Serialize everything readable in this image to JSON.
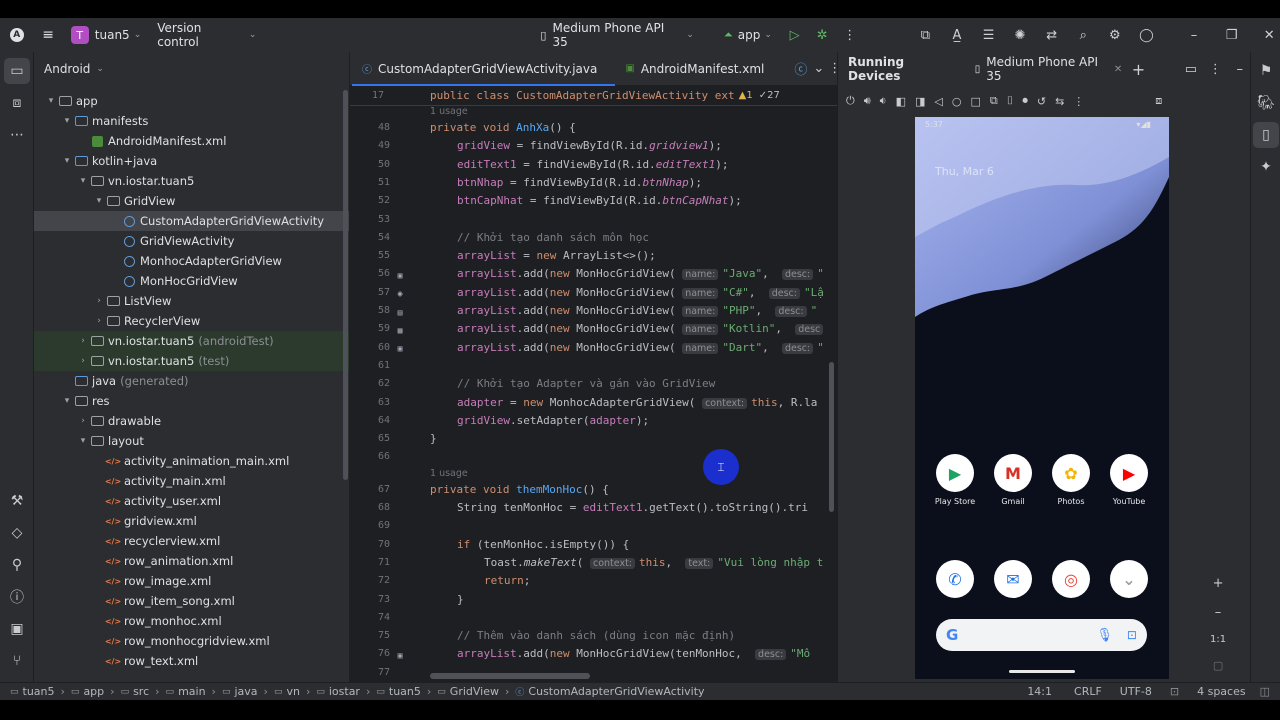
{
  "titlebar": {
    "project_initial": "T",
    "project_name": "tuan5",
    "vcs": "Version control",
    "device": "Medium Phone API 35",
    "run_config": "app"
  },
  "project_panel": {
    "view_mode": "Android",
    "tree": [
      {
        "label": "app",
        "indent": 0,
        "arrow": "▾",
        "icon": "folder"
      },
      {
        "label": "manifests",
        "indent": 1,
        "arrow": "▾",
        "icon": "folder-blue"
      },
      {
        "label": "AndroidManifest.xml",
        "indent": 2,
        "arrow": "",
        "icon": "manifest"
      },
      {
        "label": "kotlin+java",
        "indent": 1,
        "arrow": "▾",
        "icon": "folder-blue"
      },
      {
        "label": "vn.iostar.tuan5",
        "indent": 2,
        "arrow": "▾",
        "icon": "folder"
      },
      {
        "label": "GridView",
        "indent": 3,
        "arrow": "▾",
        "icon": "folder"
      },
      {
        "label": "CustomAdapterGridViewActivity",
        "indent": 4,
        "arrow": "",
        "icon": "class",
        "selected": true
      },
      {
        "label": "GridViewActivity",
        "indent": 4,
        "arrow": "",
        "icon": "class"
      },
      {
        "label": "MonhocAdapterGridView",
        "indent": 4,
        "arrow": "",
        "icon": "class"
      },
      {
        "label": "MonHocGridView",
        "indent": 4,
        "arrow": "",
        "icon": "class"
      },
      {
        "label": "ListView",
        "indent": 3,
        "arrow": "›",
        "icon": "folder"
      },
      {
        "label": "RecyclerView",
        "indent": 3,
        "arrow": "›",
        "icon": "folder"
      },
      {
        "label": "vn.iostar.tuan5",
        "suffix": "(androidTest)",
        "indent": 2,
        "arrow": "›",
        "icon": "folder",
        "green": true
      },
      {
        "label": "vn.iostar.tuan5",
        "suffix": "(test)",
        "indent": 2,
        "arrow": "›",
        "icon": "folder",
        "green": true
      },
      {
        "label": "java",
        "suffix": "(generated)",
        "indent": 1,
        "arrow": "",
        "icon": "folder-blue"
      },
      {
        "label": "res",
        "indent": 1,
        "arrow": "▾",
        "icon": "folder"
      },
      {
        "label": "drawable",
        "indent": 2,
        "arrow": "›",
        "icon": "folder"
      },
      {
        "label": "layout",
        "indent": 2,
        "arrow": "▾",
        "icon": "folder"
      },
      {
        "label": "activity_animation_main.xml",
        "indent": 3,
        "arrow": "",
        "icon": "xml"
      },
      {
        "label": "activity_main.xml",
        "indent": 3,
        "arrow": "",
        "icon": "xml"
      },
      {
        "label": "activity_user.xml",
        "indent": 3,
        "arrow": "",
        "icon": "xml"
      },
      {
        "label": "gridview.xml",
        "indent": 3,
        "arrow": "",
        "icon": "xml"
      },
      {
        "label": "recyclerview.xml",
        "indent": 3,
        "arrow": "",
        "icon": "xml"
      },
      {
        "label": "row_animation.xml",
        "indent": 3,
        "arrow": "",
        "icon": "xml"
      },
      {
        "label": "row_image.xml",
        "indent": 3,
        "arrow": "",
        "icon": "xml"
      },
      {
        "label": "row_item_song.xml",
        "indent": 3,
        "arrow": "",
        "icon": "xml"
      },
      {
        "label": "row_monhoc.xml",
        "indent": 3,
        "arrow": "",
        "icon": "xml"
      },
      {
        "label": "row_monhocgridview.xml",
        "indent": 3,
        "arrow": "",
        "icon": "xml"
      },
      {
        "label": "row_text.xml",
        "indent": 3,
        "arrow": "",
        "icon": "xml"
      }
    ]
  },
  "editor": {
    "tabs": [
      {
        "label": "CustomAdapterGridViewActivity.java",
        "active": true
      },
      {
        "label": "AndroidManifest.xml",
        "active": false
      }
    ],
    "sticky_line_no": "17",
    "sticky_code": "public class CustomAdapterGridViewActivity ext",
    "warnings": "▲1",
    "checks": "✓27",
    "lines": [
      {
        "n": "",
        "html": "<span class='usage'>1 usage</span>",
        "indent": 1
      },
      {
        "n": "48",
        "html": "<span class='kw'>private void</span> <span class='fn'>AnhXa</span>() {",
        "indent": 1
      },
      {
        "n": "49",
        "html": "<span class='fld'>gridView</span> = findViewById(R.id.<span class='it'>gridview1</span>);",
        "indent": 2
      },
      {
        "n": "50",
        "html": "<span class='fld'>editText1</span> = findViewById(R.id.<span class='it'>editText1</span>);",
        "indent": 2
      },
      {
        "n": "51",
        "html": "<span class='fld'>btnNhap</span> = findViewById(R.id.<span class='it'>btnNhap</span>);",
        "indent": 2
      },
      {
        "n": "52",
        "html": "<span class='fld'>btnCapNhat</span> = findViewById(R.id.<span class='it'>btnCapNhat</span>);",
        "indent": 2
      },
      {
        "n": "53",
        "html": "",
        "indent": 2
      },
      {
        "n": "54",
        "html": "<span class='cm'>// Khởi tạo danh sách môn học</span>",
        "indent": 2
      },
      {
        "n": "55",
        "html": "<span class='fld'>arrayList</span> = <span class='kw'>new</span> ArrayList&lt;&gt;();",
        "indent": 2
      },
      {
        "n": "56",
        "html": "<span class='fld'>arrayList</span>.add(<span class='kw'>new</span> MonHocGridView( <span class='hint'>name:</span><span class='str'>\"Java\"</span>,  <span class='hint'>desc:</span><span class='str'>\"</span>",
        "indent": 2,
        "gut": "▣"
      },
      {
        "n": "57",
        "html": "<span class='fld'>arrayList</span>.add(<span class='kw'>new</span> MonHocGridView( <span class='hint'>name:</span><span class='str'>\"C#\"</span>,  <span class='hint'>desc:</span><span class='str'>\"Lậ</span>",
        "indent": 2,
        "gut": "◉"
      },
      {
        "n": "58",
        "html": "<span class='fld'>arrayList</span>.add(<span class='kw'>new</span> MonHocGridView( <span class='hint'>name:</span><span class='str'>\"PHP\"</span>,  <span class='hint'>desc:</span><span class='str'>\"</span>",
        "indent": 2,
        "gut": "▤"
      },
      {
        "n": "59",
        "html": "<span class='fld'>arrayList</span>.add(<span class='kw'>new</span> MonHocGridView( <span class='hint'>name:</span><span class='str'>\"Kotlin\"</span>,  <span class='hint'>desc</span>",
        "indent": 2,
        "gut": "▦"
      },
      {
        "n": "60",
        "html": "<span class='fld'>arrayList</span>.add(<span class='kw'>new</span> MonHocGridView( <span class='hint'>name:</span><span class='str'>\"Dart\"</span>,  <span class='hint'>desc:</span><span class='str'>\"</span>",
        "indent": 2,
        "gut": "▣"
      },
      {
        "n": "61",
        "html": "",
        "indent": 2
      },
      {
        "n": "62",
        "html": "<span class='cm'>// Khởi tạo Adapter và gán vào GridView</span>",
        "indent": 2
      },
      {
        "n": "63",
        "html": "<span class='fld'>adapter</span> = <span class='kw'>new</span> MonhocAdapterGridView( <span class='hint'>context:</span><span class='kw'>this</span>, R.la",
        "indent": 2
      },
      {
        "n": "64",
        "html": "<span class='fld'>gridView</span>.setAdapter(<span class='fld'>adapter</span>);",
        "indent": 2
      },
      {
        "n": "65",
        "html": "}",
        "indent": 1
      },
      {
        "n": "66",
        "html": "",
        "indent": 1
      },
      {
        "n": "",
        "html": "<span class='usage'>1 usage</span>",
        "indent": 1
      },
      {
        "n": "67",
        "html": "<span class='kw'>private void</span> <span class='fn'>themMonHoc</span>() {",
        "indent": 1
      },
      {
        "n": "68",
        "html": "String tenMonHoc = <span class='fld'>editText1</span>.getText().toString().tri",
        "indent": 2
      },
      {
        "n": "69",
        "html": "",
        "indent": 2
      },
      {
        "n": "70",
        "html": "<span class='kw'>if</span> (tenMonHoc.isEmpty()) {",
        "indent": 2
      },
      {
        "n": "71",
        "html": "Toast.<span class='it' style='color:#bcbec4'>makeText</span>( <span class='hint'>context:</span><span class='kw'>this</span>,  <span class='hint'>text:</span><span class='str'>\"Vui lòng nhập t</span>",
        "indent": 3
      },
      {
        "n": "72",
        "html": "<span class='kw'>return</span>;",
        "indent": 3
      },
      {
        "n": "73",
        "html": "}",
        "indent": 2
      },
      {
        "n": "74",
        "html": "",
        "indent": 2
      },
      {
        "n": "75",
        "html": "<span class='cm'>// Thêm vào danh sách (dùng icon mặc định)</span>",
        "indent": 2
      },
      {
        "n": "76",
        "html": "<span class='fld'>arrayList</span>.add(<span class='kw'>new</span> MonHocGridView(tenMonHoc,  <span class='hint'>desc:</span><span class='str'>\"Mô</span>",
        "indent": 2,
        "gut": "▣"
      },
      {
        "n": "77",
        "html": "",
        "indent": 2
      }
    ]
  },
  "devices": {
    "title": "Running Devices",
    "tab": "Medium Phone API 35",
    "phone": {
      "time": "5:37",
      "date": "Thu, Mar 6",
      "apps_row1": [
        {
          "label": "Play Store",
          "glyph": "▶",
          "color": "#1ea362"
        },
        {
          "label": "Gmail",
          "glyph": "M",
          "color": "#d93025"
        },
        {
          "label": "Photos",
          "glyph": "✿",
          "color": "#f4b400"
        },
        {
          "label": "YouTube",
          "glyph": "▶",
          "color": "#ff0000"
        }
      ],
      "apps_row2": [
        {
          "glyph": "✆",
          "color": "#1a73e8"
        },
        {
          "glyph": "✉",
          "color": "#1a73e8"
        },
        {
          "glyph": "◎",
          "color": "#ea4335"
        },
        {
          "glyph": "⌄",
          "color": "#9aa0a6"
        }
      ],
      "search_g": "G"
    },
    "zoom": "1:1"
  },
  "statusbar": {
    "breadcrumbs": [
      "tuan5",
      "app",
      "src",
      "main",
      "java",
      "vn",
      "iostar",
      "tuan5",
      "GridView",
      "CustomAdapterGridViewActivity"
    ],
    "position": "14:1",
    "line_sep": "CRLF",
    "encoding": "UTF-8",
    "indent": "4 spaces"
  }
}
